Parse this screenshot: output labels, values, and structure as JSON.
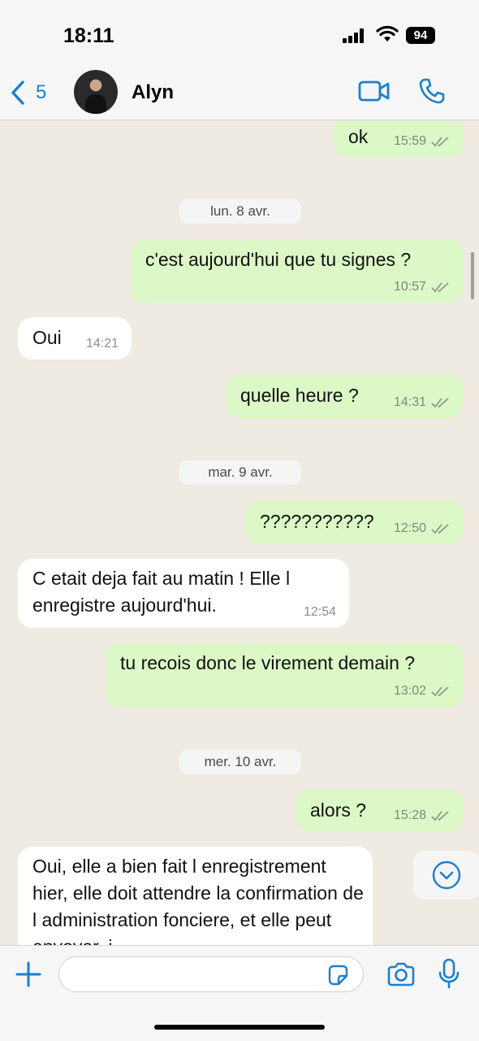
{
  "status_bar": {
    "time": "18:11",
    "battery": "94"
  },
  "header": {
    "back_count": "5",
    "contact_name": "Alyn"
  },
  "messages": [
    {
      "direction": "out",
      "text": "ok",
      "time": "15:59"
    },
    {
      "direction": "out",
      "text": "c'est aujourd'hui que tu signes ?",
      "time": "10:57"
    },
    {
      "direction": "in",
      "text": "Oui",
      "time": "14:21"
    },
    {
      "direction": "out",
      "text": "quelle heure ?",
      "time": "14:31"
    },
    {
      "direction": "out",
      "text": "???????????",
      "time": "12:50"
    },
    {
      "direction": "in",
      "text": "C etait deja fait au matin ! Elle l enregistre aujourd'hui.",
      "time": "12:54"
    },
    {
      "direction": "out",
      "text": "tu recois donc le virement demain ?",
      "time": "13:02"
    },
    {
      "direction": "out",
      "text": "alors ?",
      "time": "15:28"
    },
    {
      "direction": "in",
      "text": "Oui, elle a bien fait l enregistrement hier, elle doit attendre la confirmation de l administration fonciere, et elle peut envoyer, j",
      "time": ""
    }
  ],
  "date_separators": [
    "lun. 8 avr.",
    "mar. 9 avr.",
    "mer. 10 avr."
  ],
  "composer": {
    "input_value": ""
  },
  "icons": {
    "back": "chevron-left-icon",
    "video": "video-camera-icon",
    "call": "phone-icon",
    "ticks": "double-check-icon",
    "scroll": "chevron-down-circle-icon",
    "plus": "plus-icon",
    "sticker": "sticker-icon",
    "camera": "camera-icon",
    "mic": "microphone-icon"
  },
  "colors": {
    "accent": "#1a7fd1",
    "outgoing_bubble": "#dcf8c6",
    "incoming_bubble": "#ffffff",
    "chat_background": "#efeae2"
  }
}
